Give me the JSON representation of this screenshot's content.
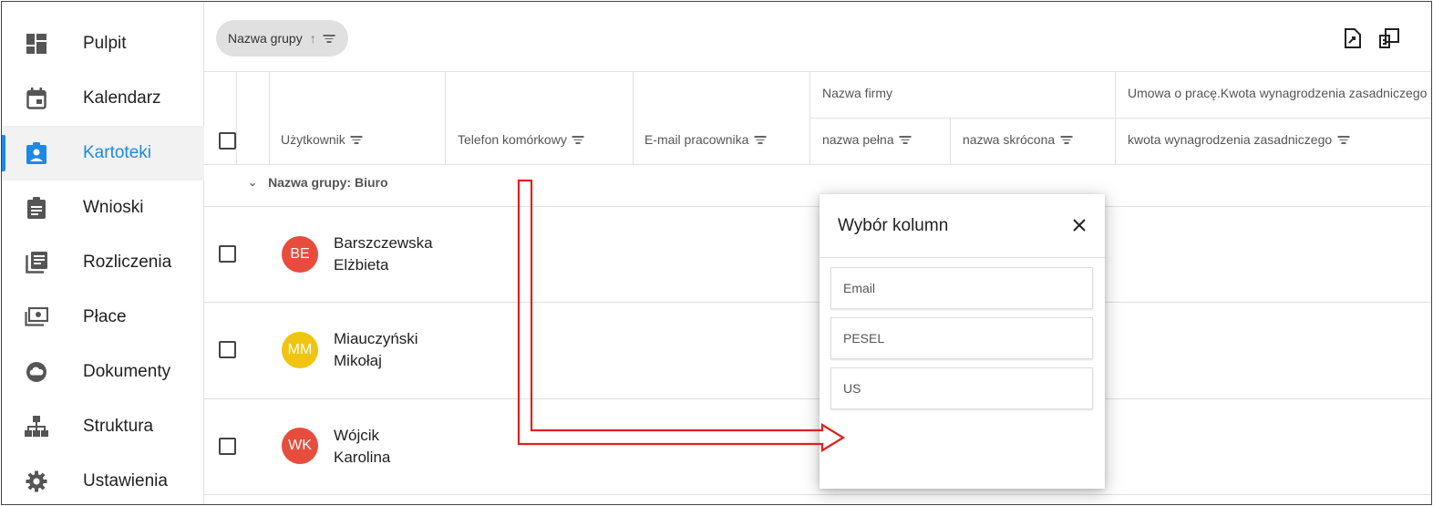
{
  "sidebar": {
    "items": [
      {
        "label": "Pulpit",
        "icon": "dashboard-icon",
        "active": false
      },
      {
        "label": "Kalendarz",
        "icon": "calendar-icon",
        "active": false
      },
      {
        "label": "Kartoteki",
        "icon": "assignment-ind-icon",
        "active": true
      },
      {
        "label": "Wnioski",
        "icon": "clipboard-icon",
        "active": false
      },
      {
        "label": "Rozliczenia",
        "icon": "library-books-icon",
        "active": false
      },
      {
        "label": "Płace",
        "icon": "money-icon",
        "active": false
      },
      {
        "label": "Dokumenty",
        "icon": "cloud-icon",
        "active": false
      },
      {
        "label": "Struktura",
        "icon": "sitemap-icon",
        "active": false
      },
      {
        "label": "Ustawienia",
        "icon": "gear-icon",
        "active": false
      }
    ],
    "accent_color": "#1e88e5"
  },
  "toolbar": {
    "group_chip_label": "Nazwa grupy",
    "export_icon": "export-file-icon",
    "column_chooser_icon": "column-chooser-icon"
  },
  "table": {
    "columns": {
      "user": "Użytkownik",
      "mobile": "Telefon komórkowy",
      "email": "E-mail pracownika",
      "company_group": "Nazwa firmy",
      "company_full": "nazwa pełna",
      "company_short": "nazwa skrócona",
      "contract_group": "Umowa o pracę.Kwota wynagrodzenia zasadniczego",
      "salary": "kwota wynagrodzenia zasadniczego"
    },
    "group_label": "Nazwa grupy: Biuro",
    "rows": [
      {
        "initials": "BE",
        "last": "Barszczewska",
        "first": "Elżbieta",
        "color": "#e84c3d"
      },
      {
        "initials": "MM",
        "last": "Miauczyński",
        "first": "Mikołaj",
        "color": "#f1c40f"
      },
      {
        "initials": "WK",
        "last": "Wójcik",
        "first": "Karolina",
        "color": "#e84c3d"
      }
    ]
  },
  "dialog": {
    "title": "Wybór kolumn",
    "options": [
      "Email",
      "PESEL",
      "US"
    ]
  },
  "annotation": {
    "arrow_color": "#e02020"
  }
}
